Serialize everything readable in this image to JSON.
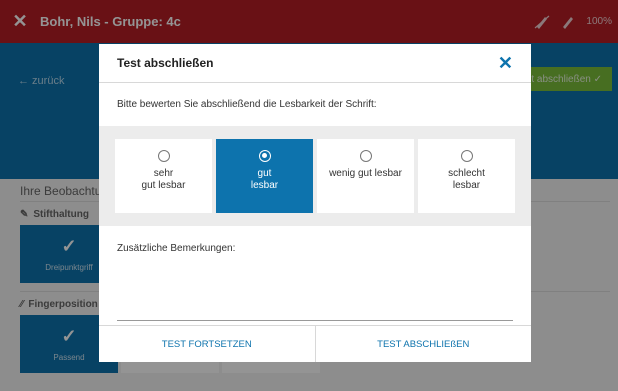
{
  "topbar": {
    "title": "Bohr, Nils - Gruppe: 4c",
    "zoom": "100%",
    "close_icon": "close-icon",
    "pen_icon": "pen-icon"
  },
  "header": {
    "back_label": "← zurück",
    "finish_label": "st abschließen ✓"
  },
  "content": {
    "observations_title": "Ihre Beobachtur",
    "sections": [
      {
        "label": "Stifthaltung",
        "tile_label": "Dreipunktgriff"
      },
      {
        "label": "Fingerposition",
        "tile_label": "Passend"
      }
    ]
  },
  "modal": {
    "title": "Test abschließen",
    "question": "Bitte bewerten Sie abschließend die Lesbarkeit der Schrift:",
    "options": [
      {
        "label": "sehr\ngut lesbar",
        "selected": false
      },
      {
        "label": "gut\nlesbar",
        "selected": true
      },
      {
        "label": "wenig gut lesbar",
        "selected": false
      },
      {
        "label": "schlecht\nlesbar",
        "selected": false
      }
    ],
    "remarks_label": "Zusätzliche Bemerkungen:",
    "remarks_value": "",
    "continue_button": "TEST FORTSETZEN",
    "finish_button": "TEST ABSCHLIEßEN"
  },
  "colors": {
    "topbar": "#b61e25",
    "primary": "#0d73ad",
    "success": "#7bbd3a"
  }
}
